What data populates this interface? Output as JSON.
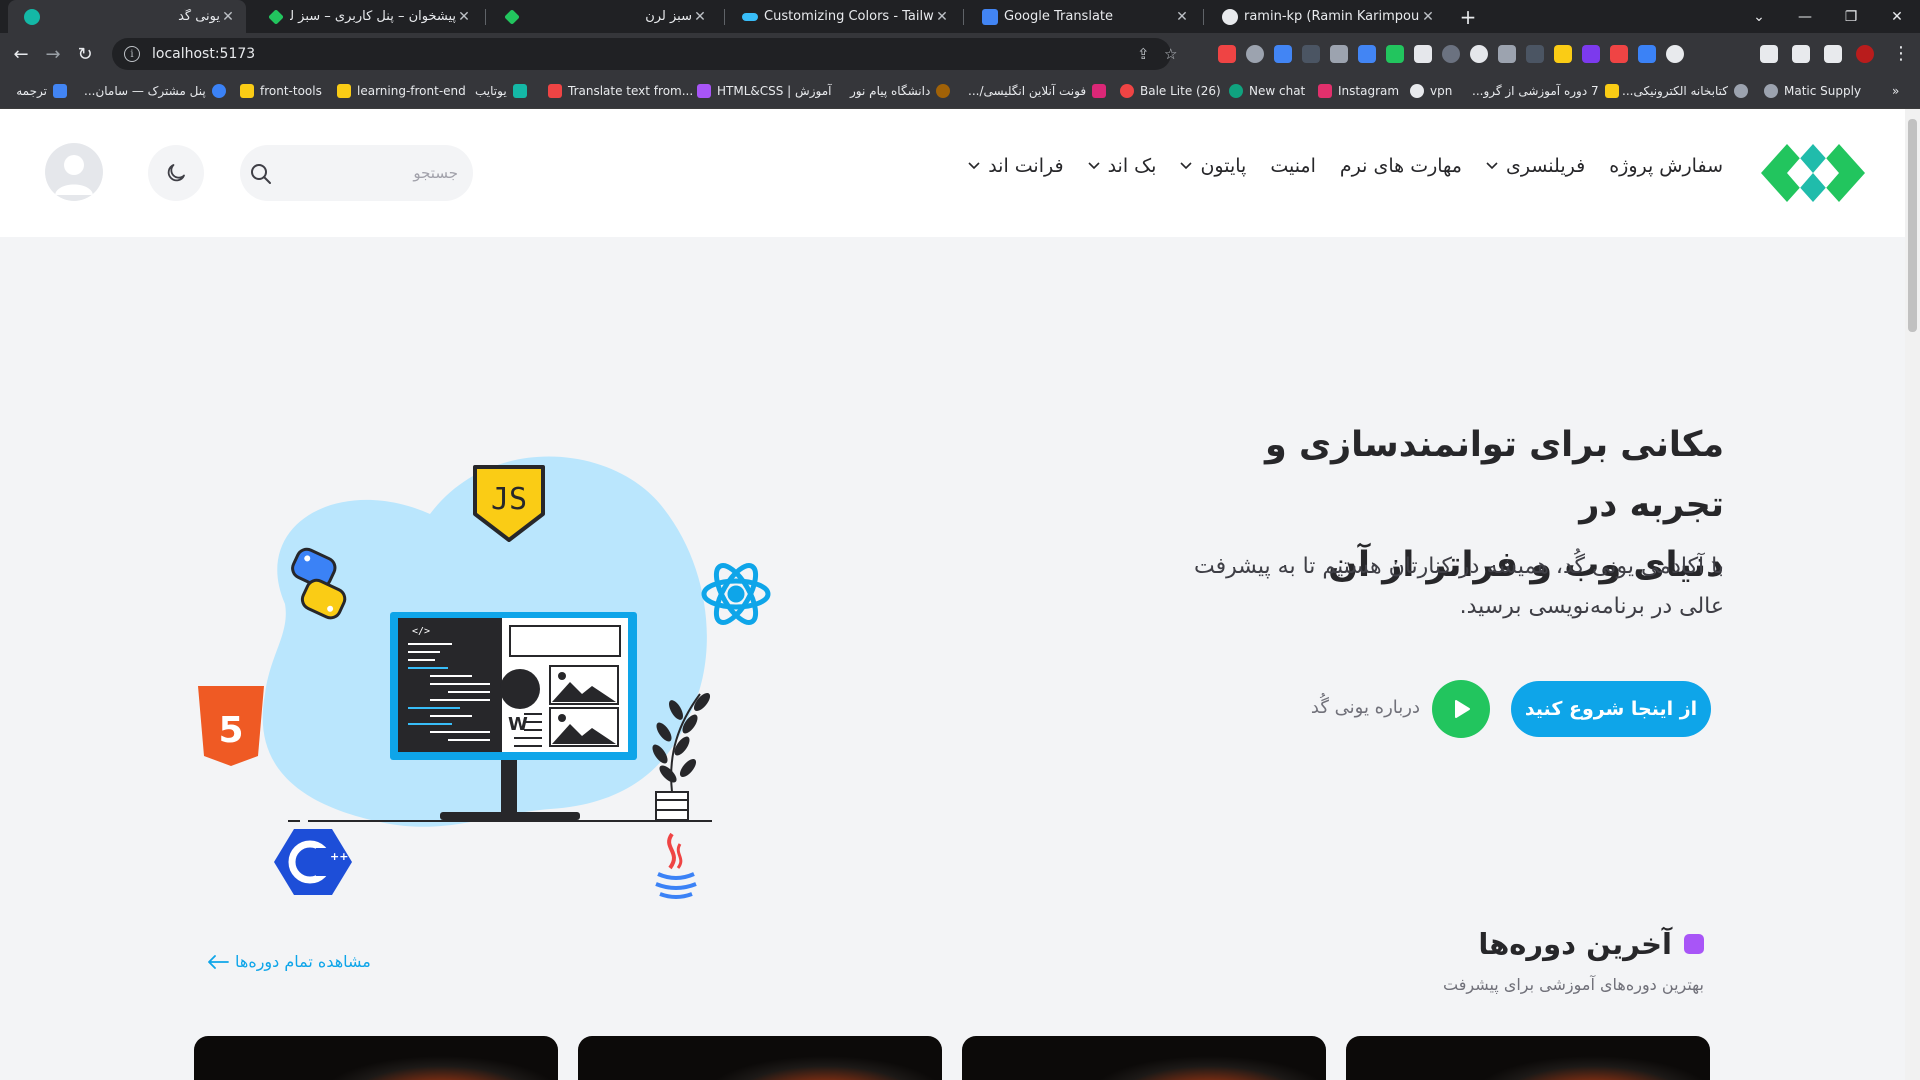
{
  "browser": {
    "tabs": [
      {
        "title": "یونی گُد",
        "active": true,
        "color": "#14b8a6"
      },
      {
        "title": "پیشخوان – پنل کاربری – سبز لرن",
        "active": false,
        "color": "#22c55e"
      },
      {
        "title": "سبز لرن",
        "active": false,
        "color": "#22c55e"
      },
      {
        "title": "Customizing Colors - Tailwind CSS",
        "active": false,
        "color": "#38bdf8"
      },
      {
        "title": "Google Translate",
        "active": false,
        "color": "#4285f4"
      },
      {
        "title": "ramin-kp (Ramin Karimpour)",
        "active": false,
        "color": "#e8eaed"
      }
    ],
    "url": "localhost:5173",
    "bookmarks": [
      {
        "label": "ترجمه",
        "color": "#4285f4"
      },
      {
        "label": "پنل مشترک — سامان...",
        "color": "#3b82f6"
      },
      {
        "label": "front-tools",
        "color": "#facc15"
      },
      {
        "label": "learning-front-end",
        "color": "#facc15"
      },
      {
        "label": "یوتایب",
        "color": "#14b8a6"
      },
      {
        "label": "Translate text from...",
        "color": "#ef4444"
      },
      {
        "label": "HTML&CSS | آموزش",
        "color": "#a855f7"
      },
      {
        "label": "دانشگاه پیام نور",
        "color": "#a16207"
      },
      {
        "label": "فونت آنلاین انگلیسی/...",
        "color": "#db2777"
      },
      {
        "label": "Bale Lite (26)",
        "color": "#ef4444"
      },
      {
        "label": "New chat",
        "color": "#10a37f"
      },
      {
        "label": "Instagram",
        "color": "#e1306c"
      },
      {
        "label": "vpn",
        "color": "#e8eaed"
      },
      {
        "label": "7 دوره آموزشی از گرو...",
        "color": "#facc15"
      },
      {
        "label": "کتابخانه الکترونیکی...",
        "color": "#9ca3af"
      },
      {
        "label": "Matic Supply",
        "color": "#9ca3af"
      }
    ]
  },
  "header": {
    "nav": [
      {
        "label": "فرانت اند",
        "dropdown": true
      },
      {
        "label": "بک اند",
        "dropdown": true
      },
      {
        "label": "پایتون",
        "dropdown": true
      },
      {
        "label": "امنیت",
        "dropdown": false
      },
      {
        "label": "مهارت های نرم",
        "dropdown": false
      },
      {
        "label": "فریلنسری",
        "dropdown": true
      },
      {
        "label": "سفارش پروژه",
        "dropdown": false
      }
    ],
    "search_placeholder": "جستجو"
  },
  "hero": {
    "title_line1": "مکانی برای توانمندسازی و تجربه در",
    "title_line2": "دنیای وب و فراتر از آن",
    "description": "با آکادمی یونی گُد، همیشه در کنارتان هستیم تا به پیشرفت عالی در برنامه‌نویسی برسید.",
    "cta_label": "از اینجا شروع کنید",
    "about_label": "درباره یونی گُد",
    "illustration_badges": [
      "JS",
      "5"
    ]
  },
  "latest_courses": {
    "title": "آخرین دوره‌ها",
    "subtitle": "بهترین دوره‌های آموزشی برای پیشرفت",
    "view_all": "مشاهده تمام دوره‌ها",
    "course_count_visible": 4
  },
  "colors": {
    "primary": "#0ea5e9",
    "play": "#22c55e",
    "accent": "#a855f7",
    "logo_green": "#22c55e",
    "logo_teal": "#14b8a6"
  }
}
